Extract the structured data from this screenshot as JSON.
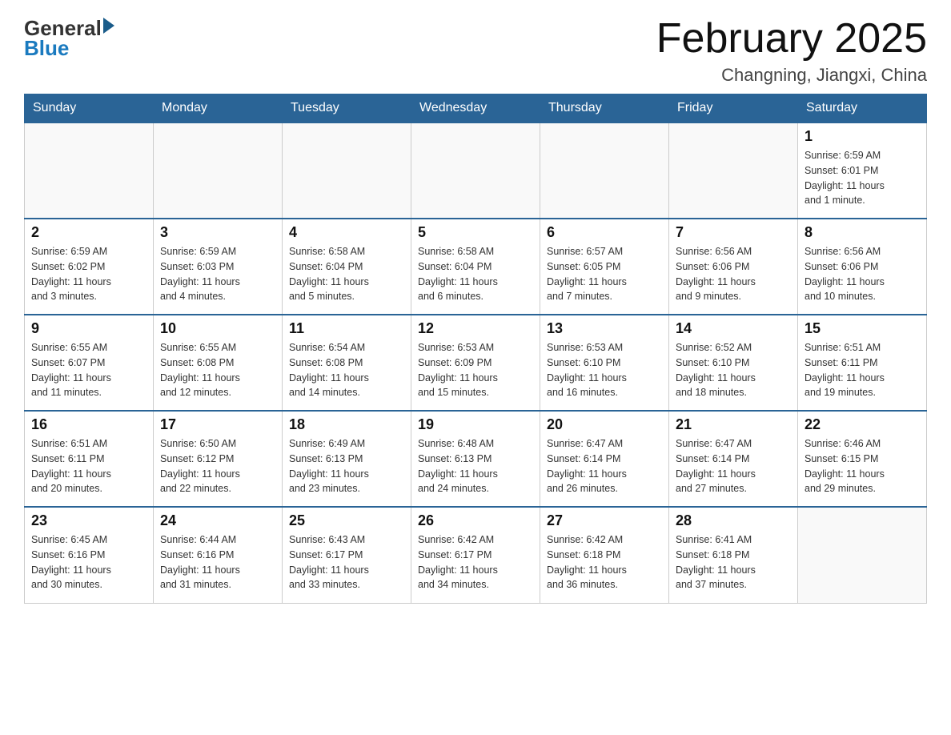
{
  "header": {
    "logo_general": "General",
    "logo_blue": "Blue",
    "month_title": "February 2025",
    "location": "Changning, Jiangxi, China"
  },
  "days_of_week": [
    "Sunday",
    "Monday",
    "Tuesday",
    "Wednesday",
    "Thursday",
    "Friday",
    "Saturday"
  ],
  "weeks": [
    [
      {
        "day": "",
        "info": ""
      },
      {
        "day": "",
        "info": ""
      },
      {
        "day": "",
        "info": ""
      },
      {
        "day": "",
        "info": ""
      },
      {
        "day": "",
        "info": ""
      },
      {
        "day": "",
        "info": ""
      },
      {
        "day": "1",
        "info": "Sunrise: 6:59 AM\nSunset: 6:01 PM\nDaylight: 11 hours\nand 1 minute."
      }
    ],
    [
      {
        "day": "2",
        "info": "Sunrise: 6:59 AM\nSunset: 6:02 PM\nDaylight: 11 hours\nand 3 minutes."
      },
      {
        "day": "3",
        "info": "Sunrise: 6:59 AM\nSunset: 6:03 PM\nDaylight: 11 hours\nand 4 minutes."
      },
      {
        "day": "4",
        "info": "Sunrise: 6:58 AM\nSunset: 6:04 PM\nDaylight: 11 hours\nand 5 minutes."
      },
      {
        "day": "5",
        "info": "Sunrise: 6:58 AM\nSunset: 6:04 PM\nDaylight: 11 hours\nand 6 minutes."
      },
      {
        "day": "6",
        "info": "Sunrise: 6:57 AM\nSunset: 6:05 PM\nDaylight: 11 hours\nand 7 minutes."
      },
      {
        "day": "7",
        "info": "Sunrise: 6:56 AM\nSunset: 6:06 PM\nDaylight: 11 hours\nand 9 minutes."
      },
      {
        "day": "8",
        "info": "Sunrise: 6:56 AM\nSunset: 6:06 PM\nDaylight: 11 hours\nand 10 minutes."
      }
    ],
    [
      {
        "day": "9",
        "info": "Sunrise: 6:55 AM\nSunset: 6:07 PM\nDaylight: 11 hours\nand 11 minutes."
      },
      {
        "day": "10",
        "info": "Sunrise: 6:55 AM\nSunset: 6:08 PM\nDaylight: 11 hours\nand 12 minutes."
      },
      {
        "day": "11",
        "info": "Sunrise: 6:54 AM\nSunset: 6:08 PM\nDaylight: 11 hours\nand 14 minutes."
      },
      {
        "day": "12",
        "info": "Sunrise: 6:53 AM\nSunset: 6:09 PM\nDaylight: 11 hours\nand 15 minutes."
      },
      {
        "day": "13",
        "info": "Sunrise: 6:53 AM\nSunset: 6:10 PM\nDaylight: 11 hours\nand 16 minutes."
      },
      {
        "day": "14",
        "info": "Sunrise: 6:52 AM\nSunset: 6:10 PM\nDaylight: 11 hours\nand 18 minutes."
      },
      {
        "day": "15",
        "info": "Sunrise: 6:51 AM\nSunset: 6:11 PM\nDaylight: 11 hours\nand 19 minutes."
      }
    ],
    [
      {
        "day": "16",
        "info": "Sunrise: 6:51 AM\nSunset: 6:11 PM\nDaylight: 11 hours\nand 20 minutes."
      },
      {
        "day": "17",
        "info": "Sunrise: 6:50 AM\nSunset: 6:12 PM\nDaylight: 11 hours\nand 22 minutes."
      },
      {
        "day": "18",
        "info": "Sunrise: 6:49 AM\nSunset: 6:13 PM\nDaylight: 11 hours\nand 23 minutes."
      },
      {
        "day": "19",
        "info": "Sunrise: 6:48 AM\nSunset: 6:13 PM\nDaylight: 11 hours\nand 24 minutes."
      },
      {
        "day": "20",
        "info": "Sunrise: 6:47 AM\nSunset: 6:14 PM\nDaylight: 11 hours\nand 26 minutes."
      },
      {
        "day": "21",
        "info": "Sunrise: 6:47 AM\nSunset: 6:14 PM\nDaylight: 11 hours\nand 27 minutes."
      },
      {
        "day": "22",
        "info": "Sunrise: 6:46 AM\nSunset: 6:15 PM\nDaylight: 11 hours\nand 29 minutes."
      }
    ],
    [
      {
        "day": "23",
        "info": "Sunrise: 6:45 AM\nSunset: 6:16 PM\nDaylight: 11 hours\nand 30 minutes."
      },
      {
        "day": "24",
        "info": "Sunrise: 6:44 AM\nSunset: 6:16 PM\nDaylight: 11 hours\nand 31 minutes."
      },
      {
        "day": "25",
        "info": "Sunrise: 6:43 AM\nSunset: 6:17 PM\nDaylight: 11 hours\nand 33 minutes."
      },
      {
        "day": "26",
        "info": "Sunrise: 6:42 AM\nSunset: 6:17 PM\nDaylight: 11 hours\nand 34 minutes."
      },
      {
        "day": "27",
        "info": "Sunrise: 6:42 AM\nSunset: 6:18 PM\nDaylight: 11 hours\nand 36 minutes."
      },
      {
        "day": "28",
        "info": "Sunrise: 6:41 AM\nSunset: 6:18 PM\nDaylight: 11 hours\nand 37 minutes."
      },
      {
        "day": "",
        "info": ""
      }
    ]
  ]
}
